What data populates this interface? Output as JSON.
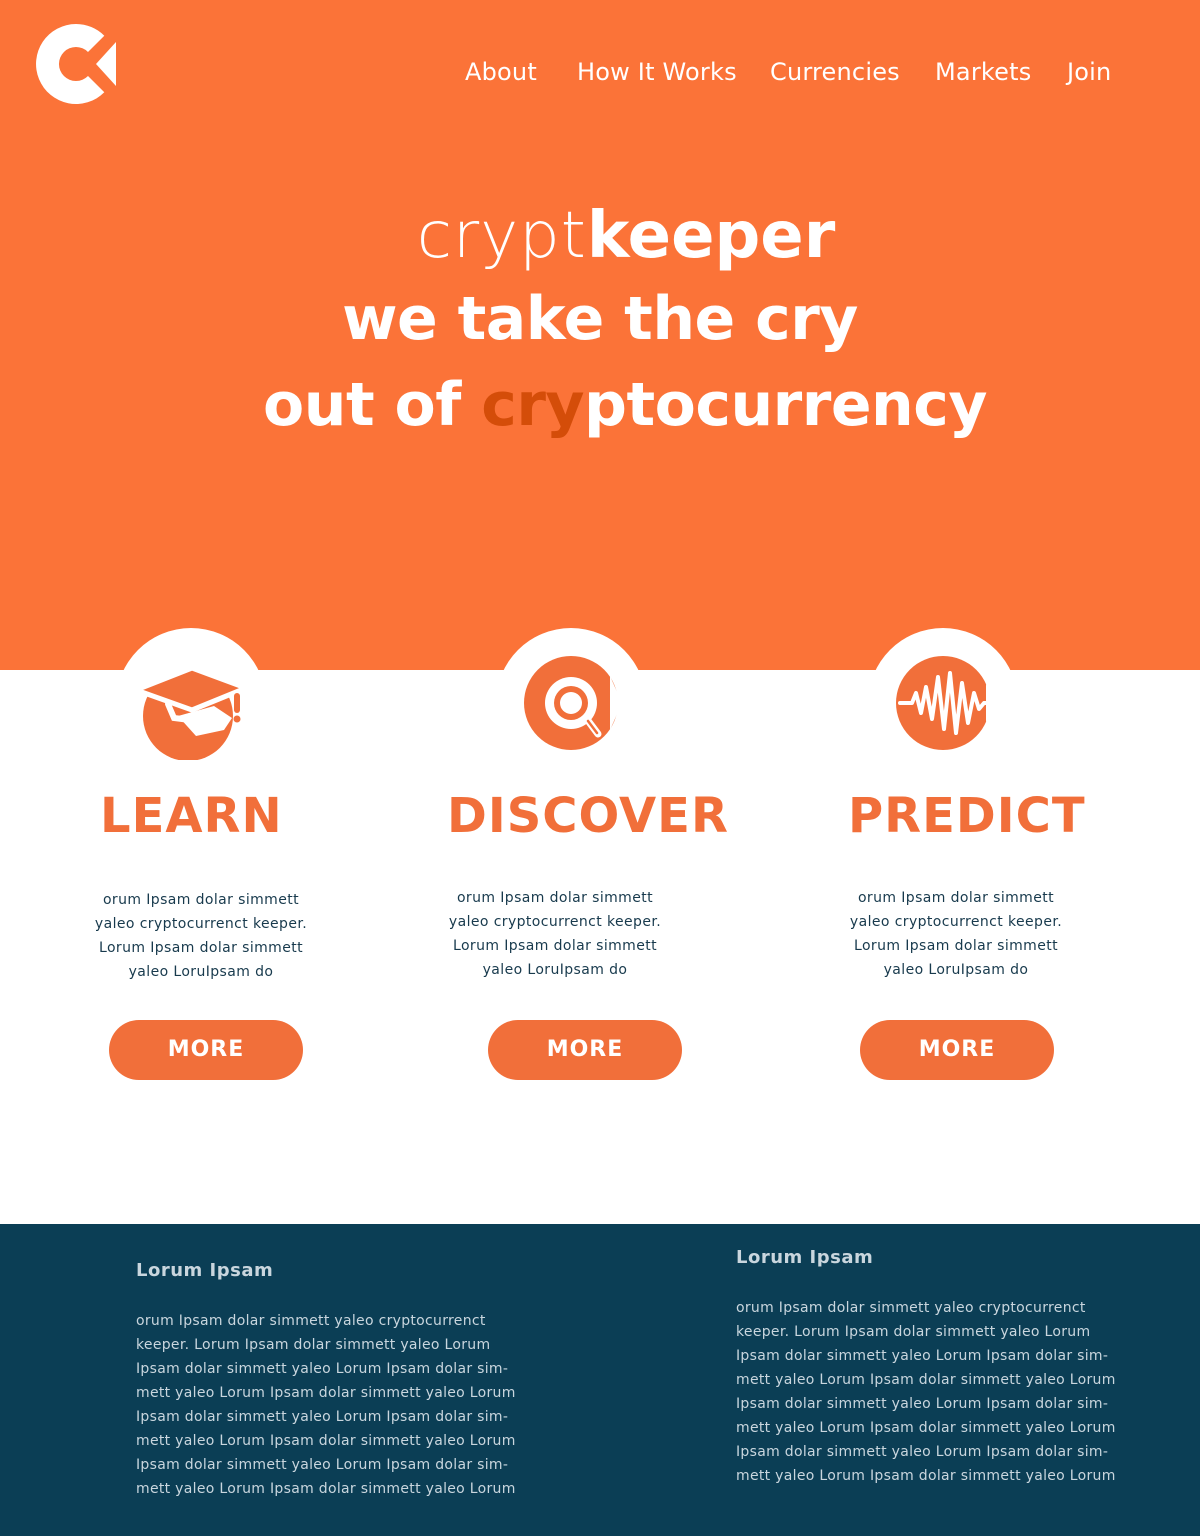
{
  "colors": {
    "brand_orange": "#fb7338",
    "accent_orange": "#f16f3a",
    "dark_accent": "#d44d09",
    "footer_navy": "#0b3e55",
    "text_navy": "#183a4d",
    "white": "#ffffff"
  },
  "header": {
    "logo_icon": "cryptkeeper-logo-icon",
    "nav": [
      "About",
      "How It Works",
      "Currencies",
      "Markets",
      "Join"
    ]
  },
  "hero": {
    "brand_light": "crypt",
    "brand_bold": "keeper",
    "tagline_line1": "we take the cry",
    "tagline_line2_prefix": "out of ",
    "tagline_line2_accent": "cry",
    "tagline_line2_suffix": "ptocurrency"
  },
  "features": [
    {
      "icon": "graduation-cap-icon",
      "title": "LEARN",
      "body": [
        "orum Ipsam dolar simmett",
        "yaleo cryptocurrenct keeper.",
        "Lorum Ipsam dolar simmett",
        "yaleo LoruIpsam do"
      ],
      "button": "MORE"
    },
    {
      "icon": "magnifier-icon",
      "title": "DISCOVER",
      "body": [
        "orum Ipsam dolar simmett",
        "yaleo cryptocurrenct keeper.",
        "Lorum Ipsam dolar simmett",
        "yaleo LoruIpsam do"
      ],
      "button": "MORE"
    },
    {
      "icon": "waveform-icon",
      "title": "PREDICT",
      "body": [
        "orum Ipsam dolar simmett",
        "yaleo cryptocurrenct keeper.",
        "Lorum Ipsam dolar simmett",
        "yaleo LoruIpsam do"
      ],
      "button": "MORE"
    }
  ],
  "footer": {
    "columns": [
      {
        "heading": "Lorum Ipsam",
        "lines": [
          "orum Ipsam dolar simmett yaleo cryptocurrenct",
          "keeper. Lorum Ipsam dolar simmett yaleo Lorum",
          "Ipsam dolar simmett yaleo Lorum Ipsam dolar sim-",
          "mett yaleo Lorum Ipsam dolar simmett yaleo Lorum",
          "Ipsam dolar simmett yaleo Lorum Ipsam dolar sim-",
          "mett yaleo Lorum Ipsam dolar simmett yaleo Lorum",
          "Ipsam dolar simmett yaleo Lorum Ipsam dolar sim-",
          "mett yaleo Lorum Ipsam dolar simmett yaleo Lorum"
        ]
      },
      {
        "heading": "Lorum Ipsam",
        "lines": [
          "orum Ipsam dolar simmett yaleo cryptocurrenct",
          "keeper. Lorum Ipsam dolar simmett yaleo Lorum",
          "Ipsam dolar simmett yaleo Lorum Ipsam dolar sim-",
          "mett yaleo Lorum Ipsam dolar simmett yaleo Lorum",
          "Ipsam dolar simmett yaleo Lorum Ipsam dolar sim-",
          "mett yaleo Lorum Ipsam dolar simmett yaleo Lorum",
          "Ipsam dolar simmett yaleo Lorum Ipsam dolar sim-",
          "mett yaleo Lorum Ipsam dolar simmett yaleo Lorum"
        ]
      }
    ]
  }
}
